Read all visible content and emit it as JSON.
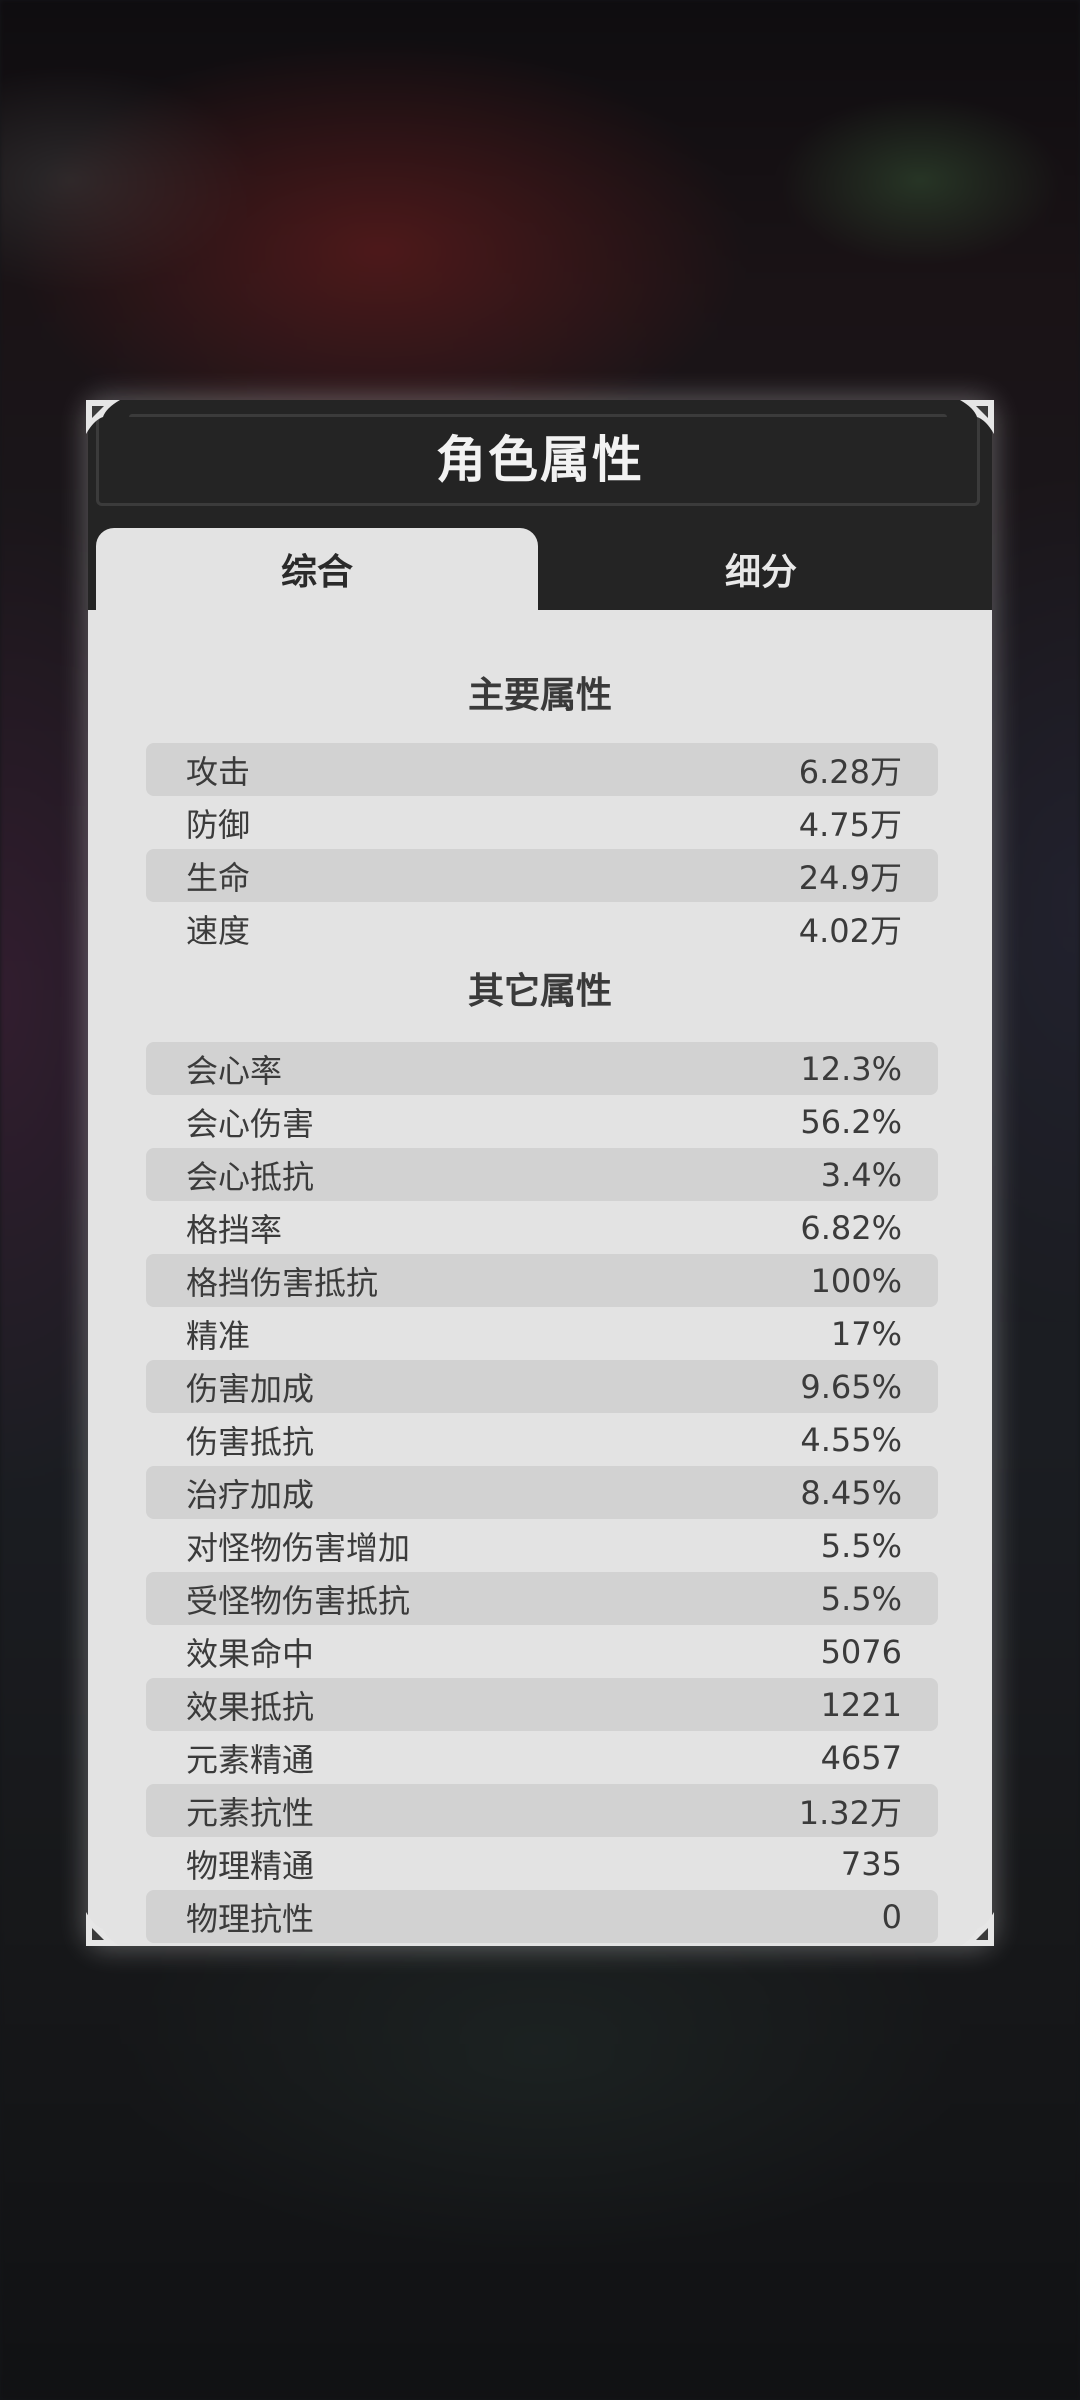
{
  "dialog": {
    "title": "角色属性",
    "tabs": [
      {
        "label": "综合",
        "active": true
      },
      {
        "label": "细分",
        "active": false
      }
    ]
  },
  "sections": {
    "main": {
      "title": "主要属性",
      "rows": [
        {
          "label": "攻击",
          "value": "6.28万"
        },
        {
          "label": "防御",
          "value": "4.75万"
        },
        {
          "label": "生命",
          "value": "24.9万"
        },
        {
          "label": "速度",
          "value": "4.02万"
        }
      ]
    },
    "other": {
      "title": "其它属性",
      "rows": [
        {
          "label": "会心率",
          "value": "12.3%"
        },
        {
          "label": "会心伤害",
          "value": "56.2%"
        },
        {
          "label": "会心抵抗",
          "value": "3.4%"
        },
        {
          "label": "格挡率",
          "value": "6.82%"
        },
        {
          "label": "格挡伤害抵抗",
          "value": "100%"
        },
        {
          "label": "精准",
          "value": "17%"
        },
        {
          "label": "伤害加成",
          "value": "9.65%"
        },
        {
          "label": "伤害抵抗",
          "value": "4.55%"
        },
        {
          "label": "治疗加成",
          "value": "8.45%"
        },
        {
          "label": "对怪物伤害增加",
          "value": "5.5%"
        },
        {
          "label": "受怪物伤害抵抗",
          "value": "5.5%"
        },
        {
          "label": "效果命中",
          "value": "5076"
        },
        {
          "label": "效果抵抗",
          "value": "1221"
        },
        {
          "label": "元素精通",
          "value": "4657"
        },
        {
          "label": "元素抗性",
          "value": "1.32万"
        },
        {
          "label": "物理精通",
          "value": "735"
        },
        {
          "label": "物理抗性",
          "value": "0"
        }
      ]
    }
  },
  "colors": {
    "panel_bg": "#e3e3e3",
    "header_bg": "#242424",
    "row_shade": "#d2d2d2",
    "text": "#3b3b3b"
  }
}
